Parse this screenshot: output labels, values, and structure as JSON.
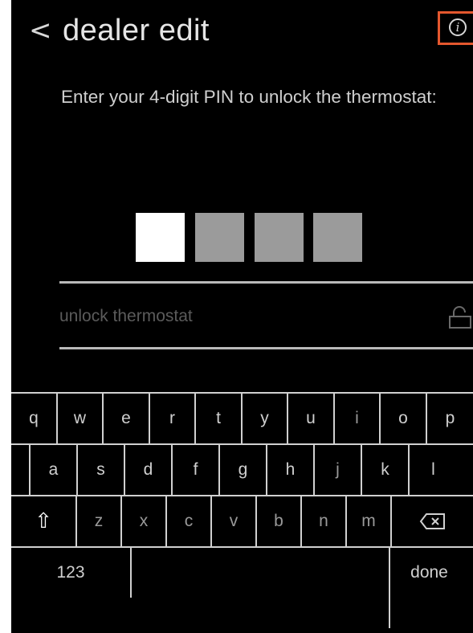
{
  "header": {
    "back_glyph": "<",
    "title": "dealer edit",
    "info_glyph": "i",
    "highlight_color": "#e4572e"
  },
  "prompt": {
    "text": "Enter your 4-digit PIN to unlock the thermostat:"
  },
  "pin": {
    "digits_total": 4,
    "digits_entered": 1,
    "filled_color": "#ffffff",
    "empty_color": "#9b9b9b"
  },
  "unlock": {
    "label": "unlock thermostat",
    "icon": "lock-icon"
  },
  "keyboard": {
    "row1": [
      "q",
      "w",
      "e",
      "r",
      "t",
      "y",
      "u",
      "i",
      "o",
      "p"
    ],
    "row2": [
      "a",
      "s",
      "d",
      "f",
      "g",
      "h",
      "j",
      "k",
      "l"
    ],
    "row3_letters": [
      "z",
      "x",
      "c",
      "v",
      "b",
      "n",
      "m"
    ],
    "shift_glyph": "⇧",
    "numbers_label": "123",
    "done_label": "done",
    "backspace_icon": "backspace-icon"
  }
}
